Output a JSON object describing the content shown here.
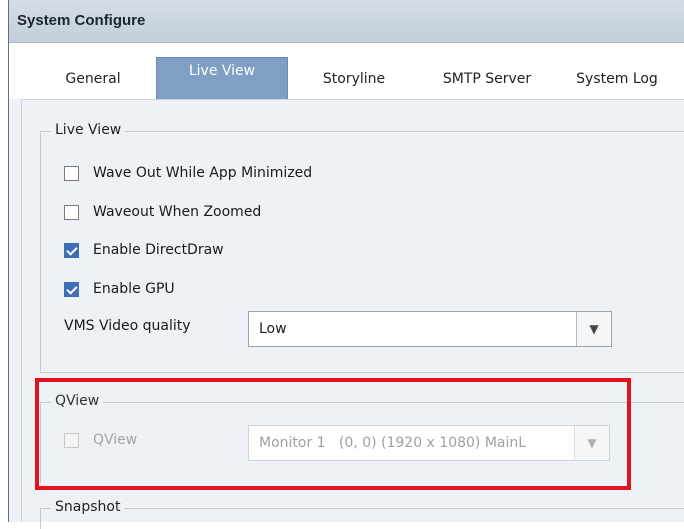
{
  "window": {
    "title": "System Configure"
  },
  "tabs": [
    {
      "label": "General",
      "active": false
    },
    {
      "label": "Live View",
      "active": true
    },
    {
      "label": "Storyline",
      "active": false
    },
    {
      "label": "SMTP Server",
      "active": false
    },
    {
      "label": "System Log",
      "active": false
    }
  ],
  "live_view": {
    "group_title": "Live View",
    "options": [
      {
        "label": "Wave Out While App Minimized",
        "checked": false
      },
      {
        "label": "Waveout When Zoomed",
        "checked": false
      },
      {
        "label": "Enable DirectDraw",
        "checked": true
      },
      {
        "label": "Enable GPU",
        "checked": true
      }
    ],
    "vms_quality": {
      "label": "VMS Video quality",
      "value": "Low",
      "dropdown_icon": "triangle-down"
    }
  },
  "qview": {
    "group_title": "QView",
    "checkbox": {
      "label": "QView",
      "checked": false,
      "enabled": false
    },
    "monitor": {
      "value": "Monitor 1   (0, 0) (1920 x 1080) MainL",
      "enabled": false,
      "dropdown_icon": "triangle-down"
    }
  },
  "snapshot": {
    "group_title": "Snapshot"
  },
  "colors": {
    "active_tab": "#7fa0c4",
    "checkbox_checked": "#3f6fb4",
    "highlight_border": "#e4121b",
    "window_background": "#eef2f6"
  }
}
